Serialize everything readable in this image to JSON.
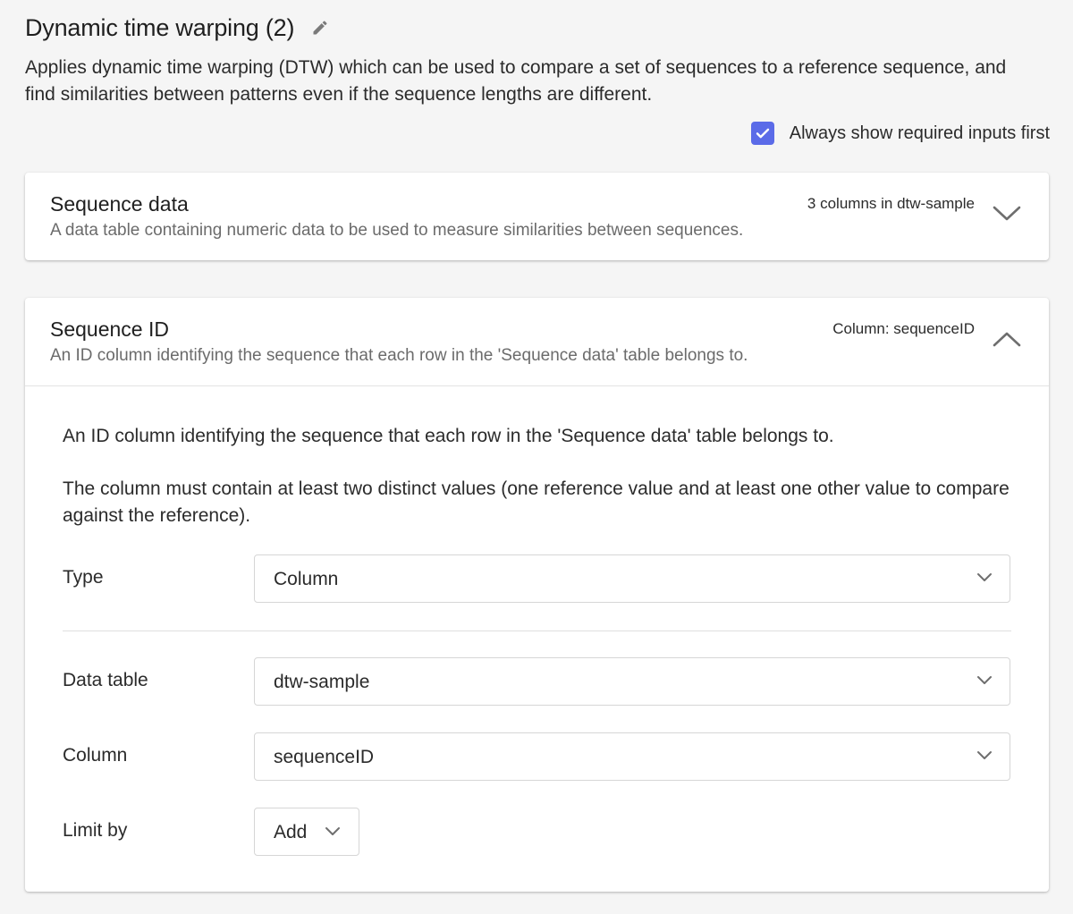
{
  "header": {
    "title": "Dynamic time warping (2)",
    "description": "Applies dynamic time warping (DTW) which can be used to compare a set of sequences to a reference sequence, and find similarities between patterns even if the sequence lengths are different.",
    "always_show_label": "Always show required inputs first",
    "always_show_checked": true
  },
  "sequence_data": {
    "title": "Sequence data",
    "subtitle": "A data table containing numeric data to be used to measure similarities between sequences.",
    "summary": "3 columns in dtw-sample",
    "expanded": false
  },
  "sequence_id": {
    "title": "Sequence ID",
    "subtitle": "An ID column identifying the sequence that each row in the 'Sequence data' table belongs to.",
    "summary": "Column: sequenceID",
    "expanded": true,
    "body_p1": "An ID column identifying the sequence that each row in the 'Sequence data' table belongs to.",
    "body_p2": "The column must contain at least two distinct values (one reference value and at least one other value to compare against the reference).",
    "fields": {
      "type": {
        "label": "Type",
        "value": "Column"
      },
      "data_table": {
        "label": "Data table",
        "value": "dtw-sample"
      },
      "column": {
        "label": "Column",
        "value": "sequenceID"
      },
      "limit_by": {
        "label": "Limit by",
        "button": "Add"
      }
    }
  },
  "colors": {
    "accent": "#5b6be8",
    "background": "#f5f5f5",
    "card": "#ffffff",
    "border": "#d6d6d6"
  }
}
